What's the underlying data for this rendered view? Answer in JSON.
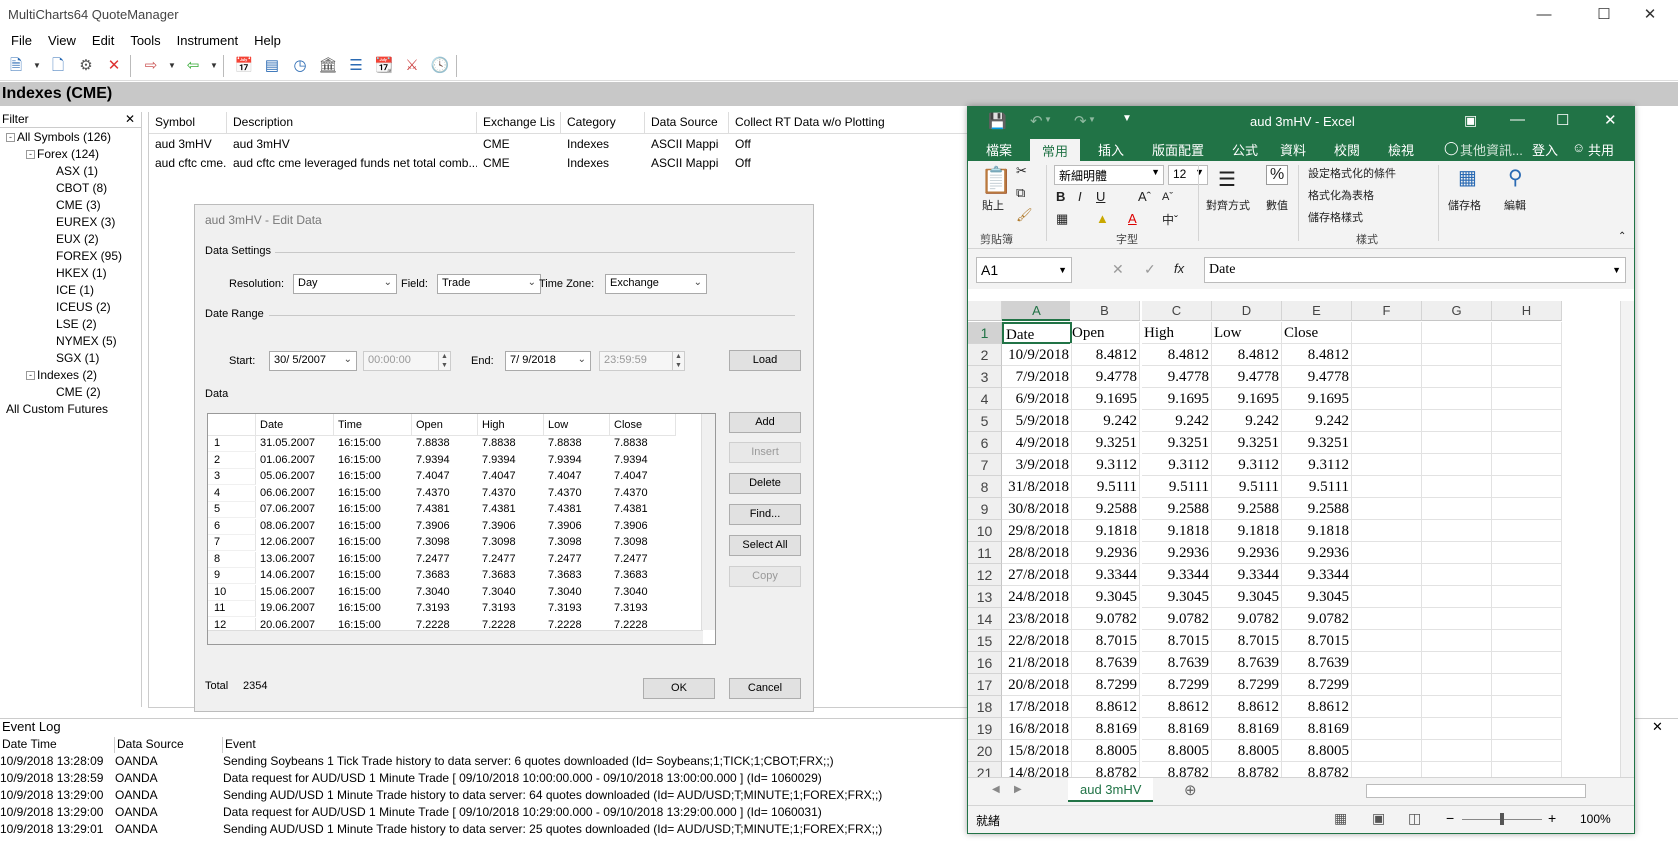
{
  "mc": {
    "title": "MultiCharts64 QuoteManager",
    "menu": [
      "File",
      "View",
      "Edit",
      "Tools",
      "Instrument",
      "Help"
    ],
    "header": "Indexes (CME)",
    "filter_label": "Filter",
    "tree": [
      {
        "label": "All Symbols (126)",
        "level": 0,
        "box": "-"
      },
      {
        "label": "Forex (124)",
        "level": 1,
        "box": "-"
      },
      {
        "label": "ASX (1)",
        "level": 2
      },
      {
        "label": "CBOT (8)",
        "level": 2
      },
      {
        "label": "CME (3)",
        "level": 2
      },
      {
        "label": "EUREX (3)",
        "level": 2
      },
      {
        "label": "EUX (2)",
        "level": 2
      },
      {
        "label": "FOREX (95)",
        "level": 2
      },
      {
        "label": "HKEX (1)",
        "level": 2
      },
      {
        "label": "ICE (1)",
        "level": 2
      },
      {
        "label": "ICEUS (2)",
        "level": 2
      },
      {
        "label": "LSE (2)",
        "level": 2
      },
      {
        "label": "NYMEX (5)",
        "level": 2
      },
      {
        "label": "SGX (1)",
        "level": 2
      },
      {
        "label": "Indexes (2)",
        "level": 1,
        "box": "-"
      },
      {
        "label": "CME (2)",
        "level": 2
      },
      {
        "label": "All Custom Futures",
        "level": 0
      }
    ],
    "grid_columns": [
      "Symbol",
      "Description",
      "Exchange Lis",
      "Category",
      "Data Source",
      "Collect RT Data w/o Plotting"
    ],
    "grid_rows": [
      [
        "aud 3mHV",
        "aud 3mHV",
        "CME",
        "Indexes",
        "ASCII Mappi",
        "Off"
      ],
      [
        "aud cftc cme...",
        "aud cftc cme leveraged funds net total comb...",
        "CME",
        "Indexes",
        "ASCII Mappi",
        "Off"
      ]
    ]
  },
  "dialog": {
    "title": "aud 3mHV - Edit Data",
    "data_settings": "Data Settings",
    "resolution_label": "Resolution:",
    "resolution": "Day",
    "field_label": "Field:",
    "field": "Trade",
    "timezone_label": "Time Zone:",
    "timezone": "Exchange",
    "date_range": "Date Range",
    "start_label": "Start:",
    "start_date": "30/ 5/2007",
    "start_time": "00:00:00",
    "end_label": "End:",
    "end_date": "7/ 9/2018",
    "end_time": "23:59:59",
    "load": "Load",
    "data_label": "Data",
    "columns": [
      "Date",
      "Time",
      "Open",
      "High",
      "Low",
      "Close"
    ],
    "rows": [
      [
        "1",
        "31.05.2007",
        "16:15:00",
        "7.8838",
        "7.8838",
        "7.8838",
        "7.8838"
      ],
      [
        "2",
        "01.06.2007",
        "16:15:00",
        "7.9394",
        "7.9394",
        "7.9394",
        "7.9394"
      ],
      [
        "3",
        "05.06.2007",
        "16:15:00",
        "7.4047",
        "7.4047",
        "7.4047",
        "7.4047"
      ],
      [
        "4",
        "06.06.2007",
        "16:15:00",
        "7.4370",
        "7.4370",
        "7.4370",
        "7.4370"
      ],
      [
        "5",
        "07.06.2007",
        "16:15:00",
        "7.4381",
        "7.4381",
        "7.4381",
        "7.4381"
      ],
      [
        "6",
        "08.06.2007",
        "16:15:00",
        "7.3906",
        "7.3906",
        "7.3906",
        "7.3906"
      ],
      [
        "7",
        "12.06.2007",
        "16:15:00",
        "7.3098",
        "7.3098",
        "7.3098",
        "7.3098"
      ],
      [
        "8",
        "13.06.2007",
        "16:15:00",
        "7.2477",
        "7.2477",
        "7.2477",
        "7.2477"
      ],
      [
        "9",
        "14.06.2007",
        "16:15:00",
        "7.3683",
        "7.3683",
        "7.3683",
        "7.3683"
      ],
      [
        "10",
        "15.06.2007",
        "16:15:00",
        "7.3040",
        "7.3040",
        "7.3040",
        "7.3040"
      ],
      [
        "11",
        "19.06.2007",
        "16:15:00",
        "7.3193",
        "7.3193",
        "7.3193",
        "7.3193"
      ],
      [
        "12",
        "20.06.2007",
        "16:15:00",
        "7.2228",
        "7.2228",
        "7.2228",
        "7.2228"
      ]
    ],
    "buttons": {
      "add": "Add",
      "insert": "Insert",
      "delete": "Delete",
      "find": "Find...",
      "select_all": "Select All",
      "copy": "Copy"
    },
    "total_label": "Total",
    "total": "2354",
    "ok": "OK",
    "cancel": "Cancel"
  },
  "log": {
    "title": "Event Log",
    "columns": [
      "Date Time",
      "Data Source",
      "Event"
    ],
    "rows": [
      [
        "10/9/2018  13:28:09",
        "OANDA",
        "Sending Soybeans 1 Tick Trade history to data server: 6 quotes downloaded (Id= Soybeans;1;TICK;1;CBOT;FRX;;)"
      ],
      [
        "10/9/2018  13:28:59",
        "OANDA",
        "Data request for AUD/USD  1 Minute Trade [ 09/10/2018 10:00:00.000  -  09/10/2018 13:00:00.000 ] (Id= 1060029)"
      ],
      [
        "10/9/2018  13:29:00",
        "OANDA",
        "Sending AUD/USD 1 Minute Trade history to data server: 64 quotes downloaded (Id= AUD/USD;T;MINUTE;1;FOREX;FRX;;)"
      ],
      [
        "10/9/2018  13:29:00",
        "OANDA",
        "Data request for AUD/USD  1 Minute Trade [ 09/10/2018 10:29:00.000  -  09/10/2018 13:29:00.000 ] (Id= 1060031)"
      ],
      [
        "10/9/2018  13:29:01",
        "OANDA",
        "Sending AUD/USD 1 Minute Trade history to data server: 25 quotes downloaded (Id= AUD/USD;T;MINUTE;1;FOREX;FRX;;)"
      ]
    ]
  },
  "excel": {
    "title": "aud 3mHV - Excel",
    "tabs": [
      "檔案",
      "常用",
      "插入",
      "版面配置",
      "公式",
      "資料",
      "校閱",
      "檢視"
    ],
    "tell_me": "其他資訊...",
    "signin": "登入",
    "share": "共用",
    "font_name": "新細明體",
    "font_size": "12",
    "cond_format": "設定格式化的條件",
    "format_table": "格式化為表格",
    "cell_styles": "儲存格樣式",
    "paste": "貼上",
    "align": "對齊方式",
    "number": "數值",
    "cells": "儲存格",
    "editing": "編輯",
    "grp_clipboard": "剪貼簿",
    "grp_font": "字型",
    "grp_styles": "樣式",
    "name_box": "A1",
    "formula": "Date",
    "fx": "fx",
    "columns": [
      "A",
      "B",
      "C",
      "D",
      "E",
      "F",
      "G",
      "H"
    ],
    "header_row": [
      "Date",
      "Open",
      "High",
      "Low",
      "Close"
    ],
    "rows": [
      [
        "10/9/2018",
        "8.4812",
        "8.4812",
        "8.4812",
        "8.4812"
      ],
      [
        "7/9/2018",
        "9.4778",
        "9.4778",
        "9.4778",
        "9.4778"
      ],
      [
        "6/9/2018",
        "9.1695",
        "9.1695",
        "9.1695",
        "9.1695"
      ],
      [
        "5/9/2018",
        "9.242",
        "9.242",
        "9.242",
        "9.242"
      ],
      [
        "4/9/2018",
        "9.3251",
        "9.3251",
        "9.3251",
        "9.3251"
      ],
      [
        "3/9/2018",
        "9.3112",
        "9.3112",
        "9.3112",
        "9.3112"
      ],
      [
        "31/8/2018",
        "9.5111",
        "9.5111",
        "9.5111",
        "9.5111"
      ],
      [
        "30/8/2018",
        "9.2588",
        "9.2588",
        "9.2588",
        "9.2588"
      ],
      [
        "29/8/2018",
        "9.1818",
        "9.1818",
        "9.1818",
        "9.1818"
      ],
      [
        "28/8/2018",
        "9.2936",
        "9.2936",
        "9.2936",
        "9.2936"
      ],
      [
        "27/8/2018",
        "9.3344",
        "9.3344",
        "9.3344",
        "9.3344"
      ],
      [
        "24/8/2018",
        "9.3045",
        "9.3045",
        "9.3045",
        "9.3045"
      ],
      [
        "23/8/2018",
        "9.0782",
        "9.0782",
        "9.0782",
        "9.0782"
      ],
      [
        "22/8/2018",
        "8.7015",
        "8.7015",
        "8.7015",
        "8.7015"
      ],
      [
        "21/8/2018",
        "8.7639",
        "8.7639",
        "8.7639",
        "8.7639"
      ],
      [
        "20/8/2018",
        "8.7299",
        "8.7299",
        "8.7299",
        "8.7299"
      ],
      [
        "17/8/2018",
        "8.8612",
        "8.8612",
        "8.8612",
        "8.8612"
      ],
      [
        "16/8/2018",
        "8.8169",
        "8.8169",
        "8.8169",
        "8.8169"
      ],
      [
        "15/8/2018",
        "8.8005",
        "8.8005",
        "8.8005",
        "8.8005"
      ],
      [
        "14/8/2018",
        "8.8782",
        "8.8782",
        "8.8782",
        "8.8782"
      ]
    ],
    "sheet_tab": "aud 3mHV",
    "status": "就緒",
    "zoom": "100%",
    "colors": {
      "brand": "#217346"
    }
  }
}
